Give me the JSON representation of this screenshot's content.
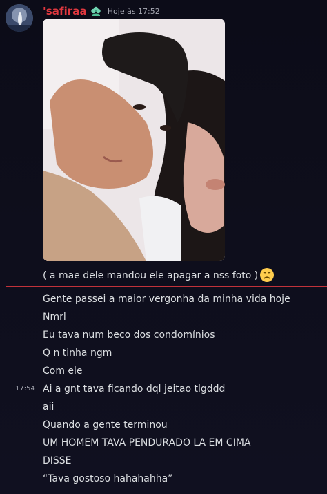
{
  "message_group": {
    "author": "'safiraa",
    "timestamp": "Hoje às 17:52",
    "caption": "( a mae dele mandou ele apagar a nss foto )",
    "caption_emoji": "disappointed-face-icon"
  },
  "new_messages_divider_color": "#e0383f",
  "hover_timestamp": "17:54",
  "messages": [
    "Gente passei a maior vergonha da minha vida hoje",
    "Nmrl",
    "Eu tava num beco dos condomínios",
    "Q n tinha ngm",
    "Com ele",
    "Ai a gnt tava ficando dql jeitao tlgddd",
    "aii",
    "Quando a gente terminou",
    "UM HOMEM TAVA PENDURADO LA EM CIMA",
    "DISSE",
    "“Tava gostoso hahahahha”"
  ],
  "colors": {
    "username": "#e0383f",
    "background": "#0f0f1c",
    "text": "#dbdee1",
    "muted": "#a7a9b3"
  }
}
